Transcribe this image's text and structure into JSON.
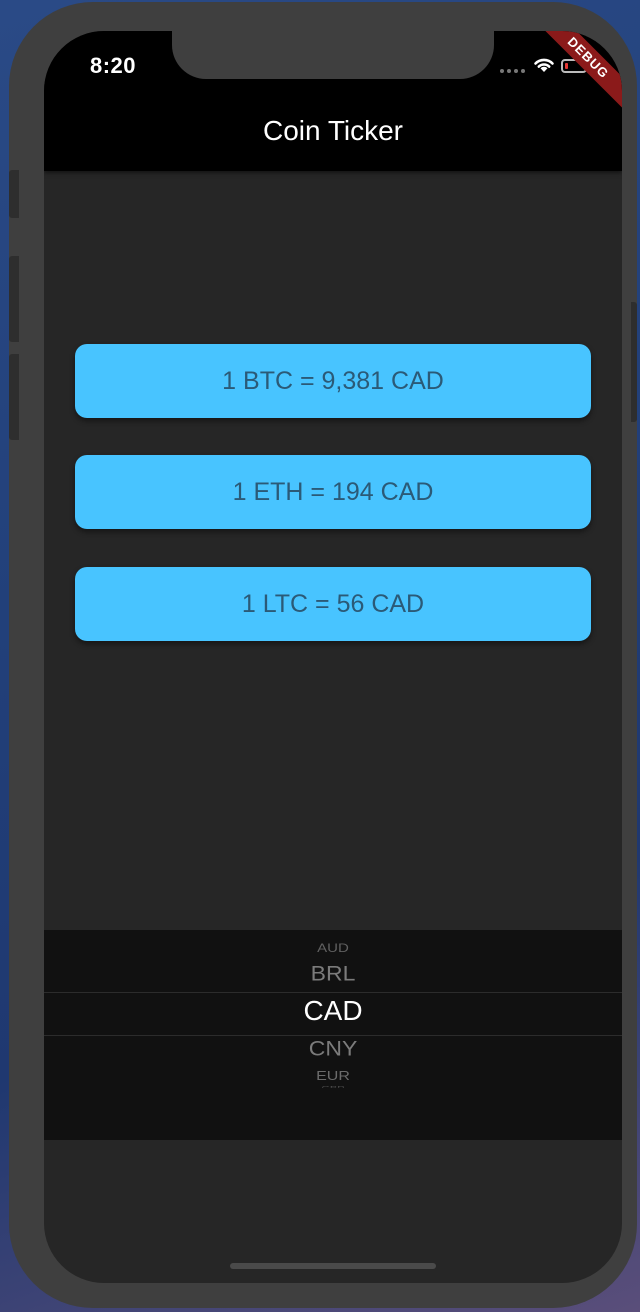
{
  "status": {
    "time": "8:20",
    "debug_banner": "DEBUG"
  },
  "appbar": {
    "title": "Coin Ticker"
  },
  "rates": [
    {
      "text": "1 BTC = 9,381 CAD"
    },
    {
      "text": "1 ETH = 194 CAD"
    },
    {
      "text": "1 LTC = 56 CAD"
    }
  ],
  "picker": {
    "items": [
      "AUD",
      "BRL",
      "CAD",
      "CNY",
      "EUR",
      "GBP"
    ],
    "selected": "CAD"
  },
  "colors": {
    "card": "#48c4ff",
    "card_text": "#2b5a77",
    "background": "#262626",
    "appbar": "#000000",
    "debug_ribbon": "#8b1a1a"
  },
  "icons": [
    "cellular-signal-icon",
    "wifi-icon",
    "battery-icon"
  ]
}
